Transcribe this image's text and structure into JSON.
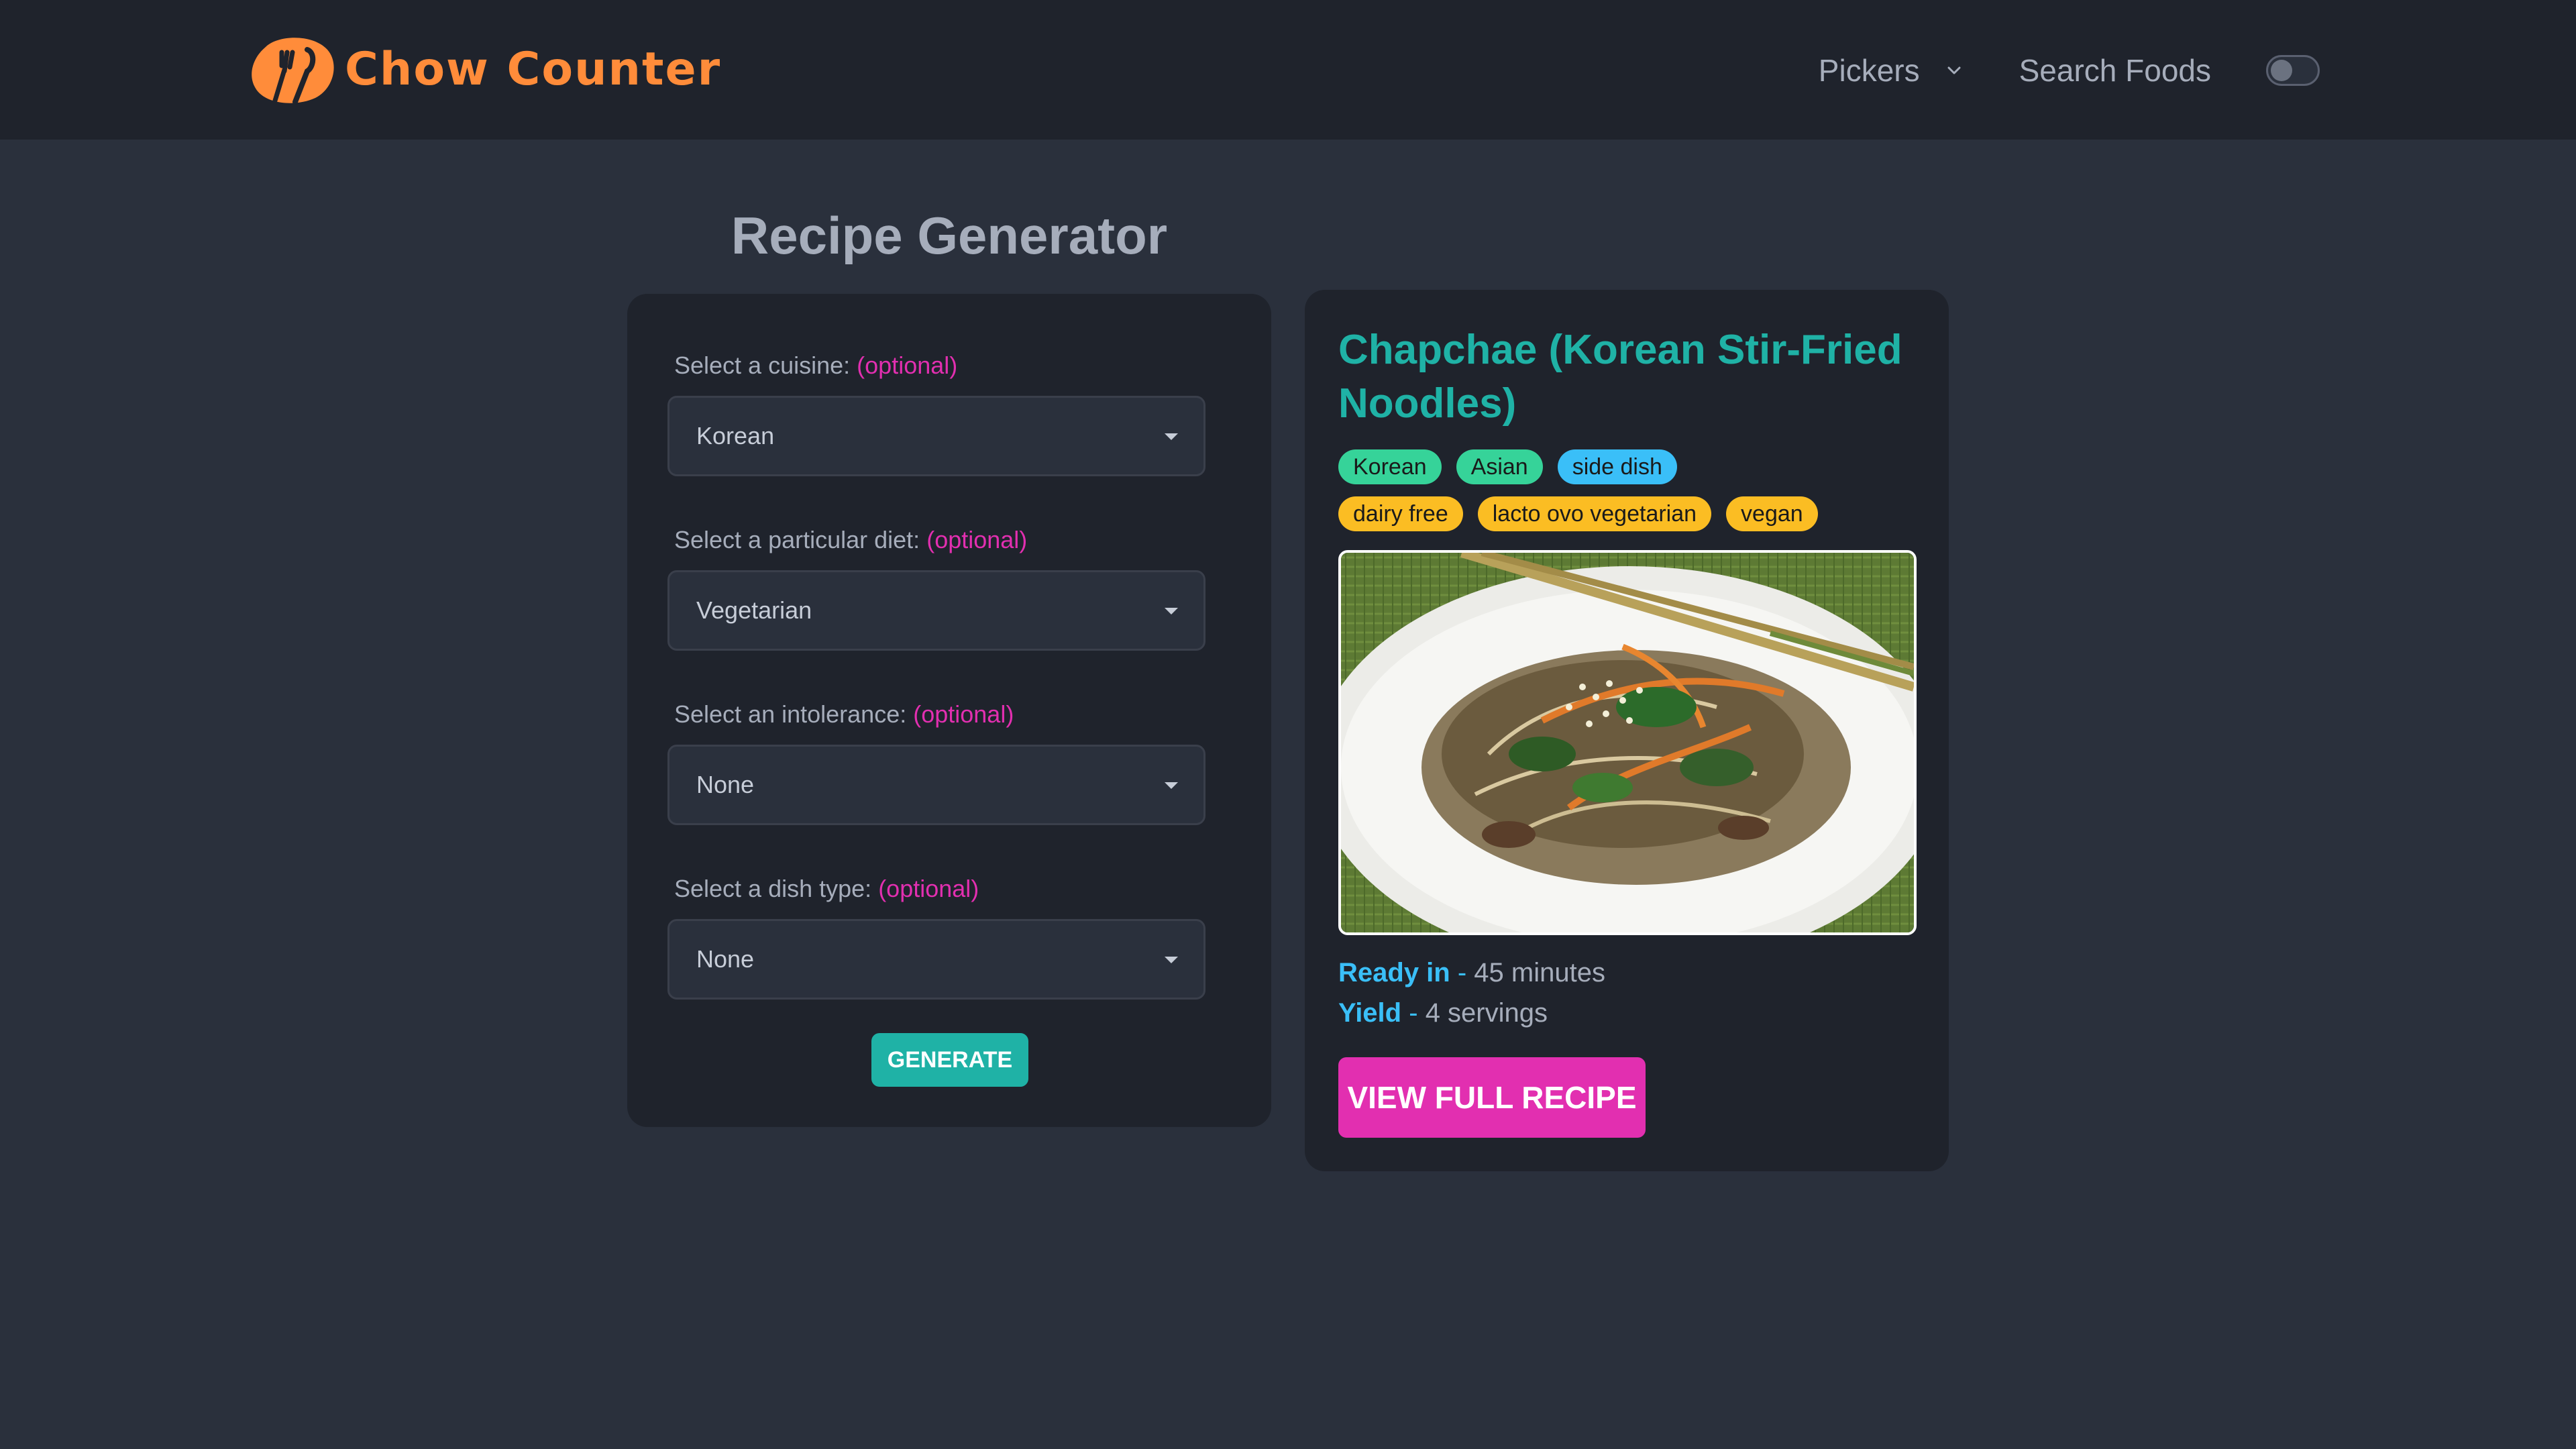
{
  "nav": {
    "brand": "Chow Counter",
    "pickers_label": "Pickers",
    "search_label": "Search Foods",
    "theme_toggle_on": false,
    "brand_color": "#ff8c3a"
  },
  "page_title": "Recipe Generator",
  "form": {
    "cuisine": {
      "label": "Select a cuisine:",
      "optional": "(optional)",
      "value": "Korean"
    },
    "diet": {
      "label": "Select a particular diet:",
      "optional": "(optional)",
      "value": "Vegetarian"
    },
    "intolerance": {
      "label": "Select an intolerance:",
      "optional": "(optional)",
      "value": "None"
    },
    "dish_type": {
      "label": "Select a dish type:",
      "optional": "(optional)",
      "value": "None"
    },
    "generate_label": "GENERATE"
  },
  "recipe": {
    "title": "Chapchae (Korean Stir-Fried Noodles)",
    "cuisine_tags": [
      "Korean",
      "Asian"
    ],
    "dish_tags": [
      "side dish"
    ],
    "diet_tags": [
      "dairy free",
      "lacto ovo vegetarian",
      "vegan"
    ],
    "ready_label": "Ready in",
    "ready_value": "45 minutes",
    "yield_label": "Yield",
    "yield_value": "4 servings",
    "dash": "-",
    "view_label": "VIEW FULL RECIPE"
  },
  "colors": {
    "teal": "#1fb2a6",
    "pink": "#e22fb0",
    "sky": "#3abff8",
    "green_badge": "#36d399",
    "yellow_badge": "#fbbd23"
  }
}
